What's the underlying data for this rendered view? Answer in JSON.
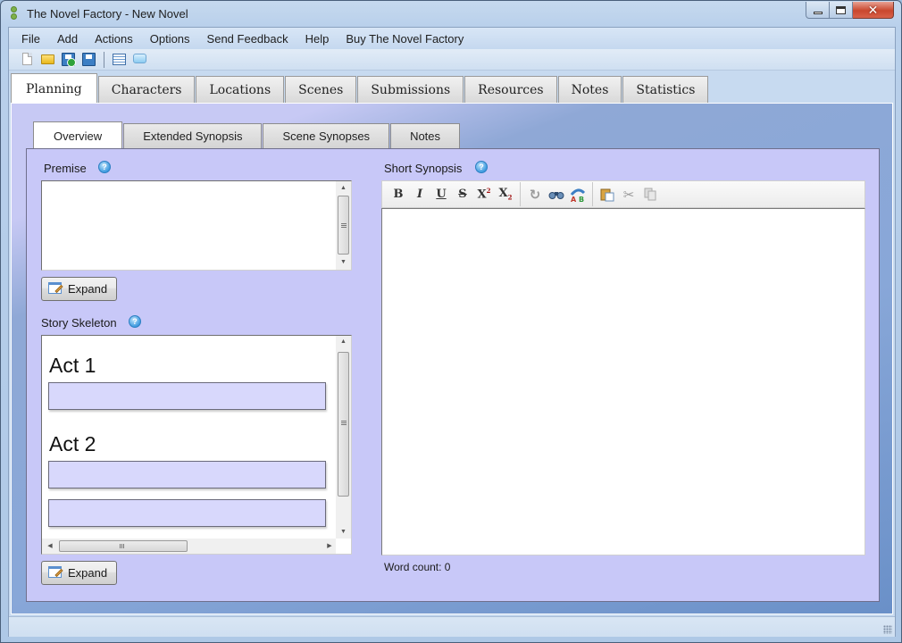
{
  "window": {
    "title": "The Novel Factory - New Novel",
    "controls": {
      "minimize": "minimize",
      "maximize": "maximize",
      "close": "✕"
    }
  },
  "menubar": {
    "items": [
      "File",
      "Add",
      "Actions",
      "Options",
      "Send Feedback",
      "Help",
      "Buy The Novel Factory"
    ]
  },
  "toolbar": {
    "buttons": [
      {
        "name": "new-document",
        "icon": "new-document-icon"
      },
      {
        "name": "open-folder",
        "icon": "folder-icon"
      },
      {
        "name": "save-as",
        "icon": "save-as-icon"
      },
      {
        "name": "save",
        "icon": "save-icon"
      },
      {
        "name": "outline",
        "icon": "list-view-icon"
      },
      {
        "name": "comment",
        "icon": "speech-bubble-icon"
      }
    ]
  },
  "main_tabs": {
    "active": "Planning",
    "items": [
      "Planning",
      "Characters",
      "Locations",
      "Scenes",
      "Submissions",
      "Resources",
      "Notes",
      "Statistics"
    ]
  },
  "sub_tabs": {
    "active": "Overview",
    "items": [
      "Overview",
      "Extended Synopsis",
      "Scene Synopses",
      "Notes"
    ]
  },
  "overview": {
    "premise": {
      "label": "Premise",
      "value": "",
      "help": "?"
    },
    "expand_label": "Expand",
    "story_skeleton": {
      "label": "Story Skeleton",
      "help": "?",
      "acts": [
        {
          "title": "Act 1",
          "fields": [
            ""
          ]
        },
        {
          "title": "Act 2",
          "fields": [
            "",
            ""
          ]
        }
      ]
    },
    "short_synopsis": {
      "label": "Short Synopsis",
      "help": "?",
      "value": "",
      "word_count": "Word count: 0",
      "toolbar": {
        "format": [
          {
            "name": "bold",
            "label": "B"
          },
          {
            "name": "italic",
            "label": "I"
          },
          {
            "name": "underline",
            "label": "U"
          },
          {
            "name": "strikethrough",
            "label": "S"
          },
          {
            "name": "superscript",
            "label": "X",
            "mark": "2"
          },
          {
            "name": "subscript",
            "label": "X",
            "mark": "2"
          }
        ],
        "tools": [
          "redo",
          "find",
          "replace"
        ],
        "clipboard": [
          "paste",
          "cut",
          "copy"
        ]
      }
    }
  }
}
